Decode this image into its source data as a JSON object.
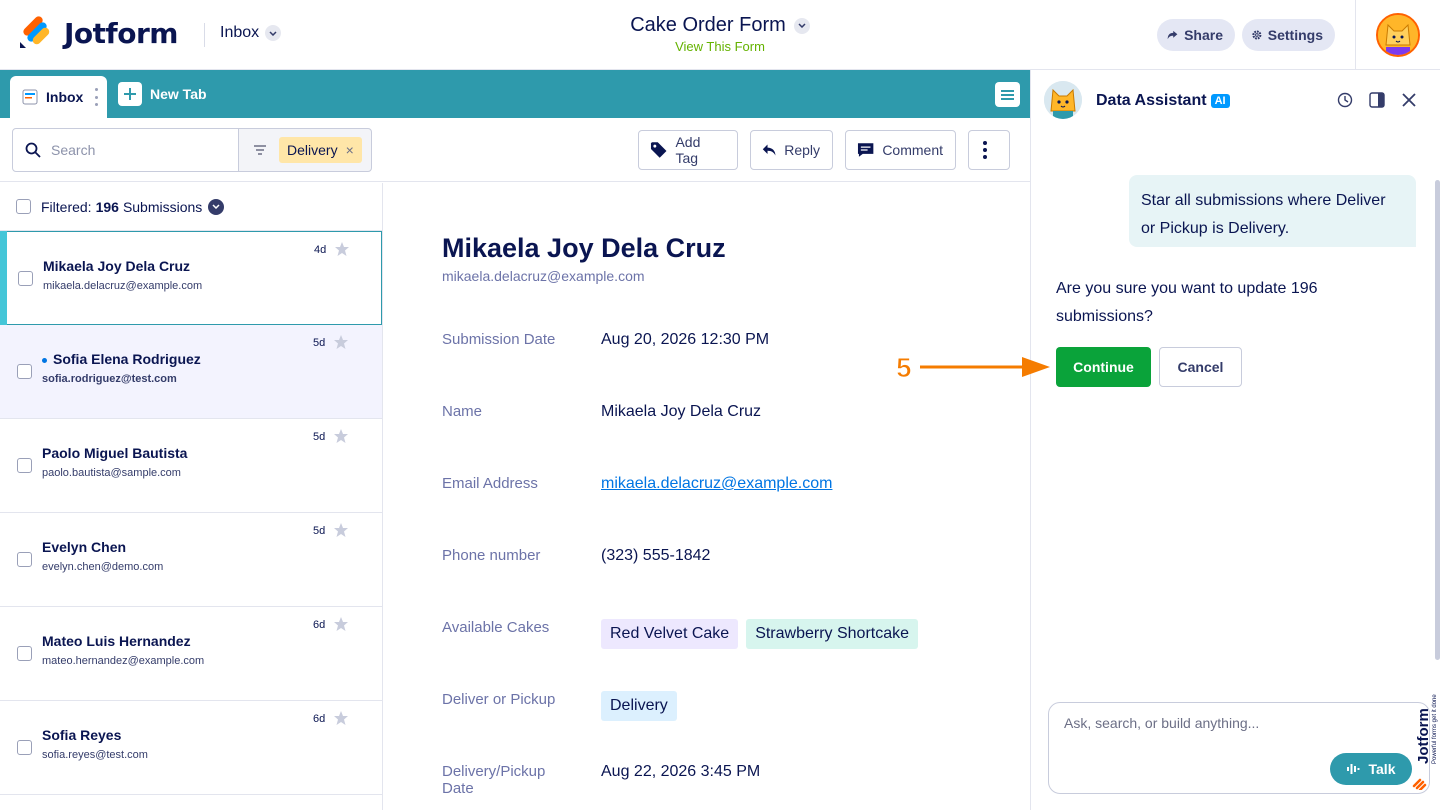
{
  "header": {
    "logo_text": "Jotform",
    "inbox_label": "Inbox",
    "form_title": "Cake Order Form",
    "view_form": "View This Form",
    "share_label": "Share",
    "settings_label": "Settings"
  },
  "tabs": {
    "inbox_label": "Inbox",
    "new_tab_label": "New Tab"
  },
  "toolbar": {
    "search_placeholder": "Search",
    "filter_chip": "Delivery",
    "filter_chip_remove": "×",
    "add_tag_label": "Add Tag",
    "reply_label": "Reply",
    "comment_label": "Comment"
  },
  "list": {
    "filtered_label": "Filtered:",
    "count": "196",
    "count_suffix": "Submissions",
    "rows": [
      {
        "name": "Mikaela Joy Dela Cruz",
        "email": "mikaela.delacruz@example.com",
        "age": "4d"
      },
      {
        "name": "Sofia Elena Rodriguez",
        "email": "sofia.rodriguez@test.com",
        "age": "5d"
      },
      {
        "name": "Paolo Miguel Bautista",
        "email": "paolo.bautista@sample.com",
        "age": "5d"
      },
      {
        "name": "Evelyn Chen",
        "email": "evelyn.chen@demo.com",
        "age": "5d"
      },
      {
        "name": "Mateo Luis Hernandez",
        "email": "mateo.hernandez@example.com",
        "age": "6d"
      },
      {
        "name": "Sofia Reyes",
        "email": "sofia.reyes@test.com",
        "age": "6d"
      }
    ]
  },
  "detail": {
    "name": "Mikaela Joy Dela Cruz",
    "email": "mikaela.delacruz@example.com",
    "fields": {
      "submission_date": {
        "label": "Submission Date",
        "value": "Aug 20, 2026 12:30 PM"
      },
      "name": {
        "label": "Name",
        "value": "Mikaela Joy Dela Cruz"
      },
      "email": {
        "label": "Email Address",
        "value": "mikaela.delacruz@example.com"
      },
      "phone": {
        "label": "Phone number",
        "value": "(323) 555-1842"
      },
      "cakes": {
        "label": "Available Cakes",
        "values": [
          "Red Velvet Cake",
          "Strawberry Shortcake"
        ]
      },
      "delivery": {
        "label": "Deliver or Pickup",
        "value": "Delivery"
      },
      "delivery_date": {
        "label": "Delivery/Pickup Date",
        "value": "Aug 22, 2026 3:45 PM"
      }
    }
  },
  "assistant": {
    "title": "Data Assistant",
    "badge": "AI",
    "user_message": "Star all submissions where Deliver or Pickup is Delivery.",
    "bot_message": "Are you sure you want to update 196 submissions?",
    "continue_label": "Continue",
    "cancel_label": "Cancel",
    "composer_placeholder": "Ask, search, or build anything...",
    "talk_label": "Talk",
    "side_brand": "Jotform",
    "side_tagline": "Powerful forms get it done"
  },
  "annotation": {
    "step_number": "5"
  },
  "colors": {
    "teal": "#2e9aac",
    "navy": "#0a1551",
    "green": "#0aa33a",
    "accent_orange": "#f57c00"
  }
}
